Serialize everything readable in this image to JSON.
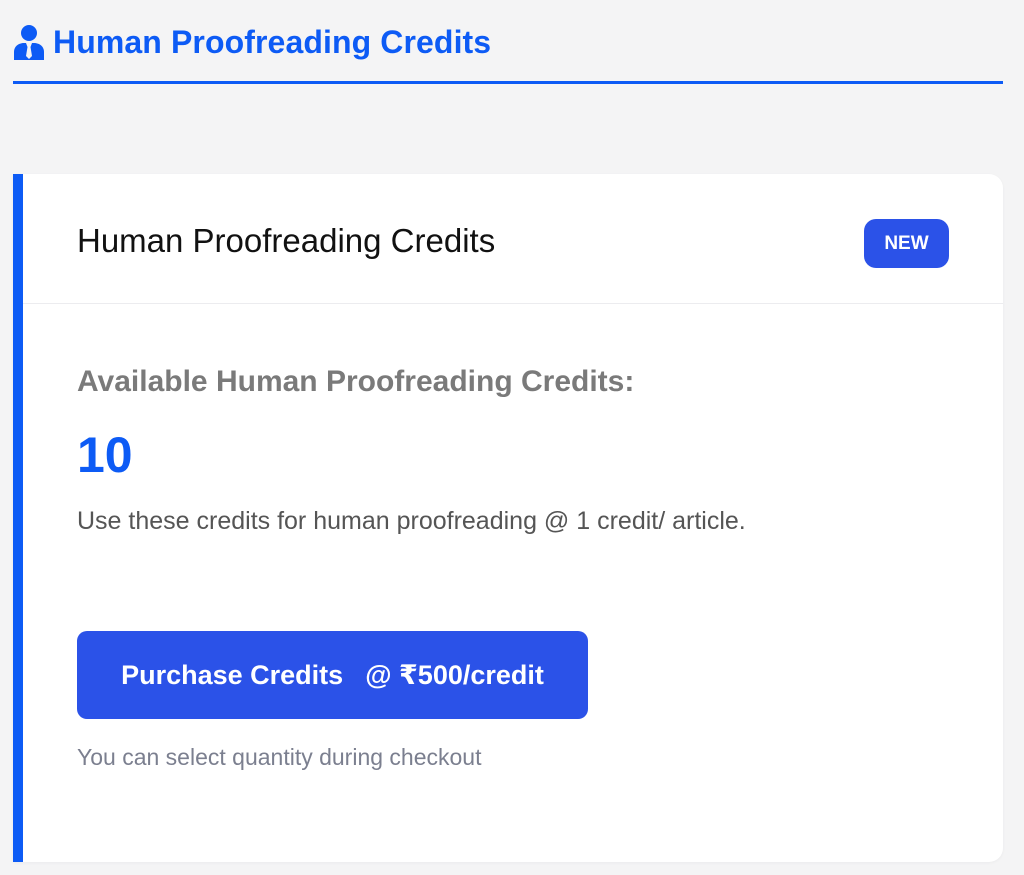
{
  "header": {
    "icon": "user-tie-icon",
    "title": "Human Proofreading Credits"
  },
  "card": {
    "title": "Human Proofreading Credits",
    "badge": "NEW",
    "available_label": "Available Human Proofreading Credits:",
    "credit_count": "10",
    "usage_text": "Use these credits for human proofreading @ 1 credit/ article.",
    "purchase_button": {
      "label": "Purchase Credits",
      "price": "@ ₹500/credit"
    },
    "checkout_note": "You can select quantity during checkout"
  },
  "colors": {
    "accent": "#0d5bf5",
    "button": "#2b52e8",
    "background": "#f4f4f5",
    "card": "#ffffff"
  }
}
